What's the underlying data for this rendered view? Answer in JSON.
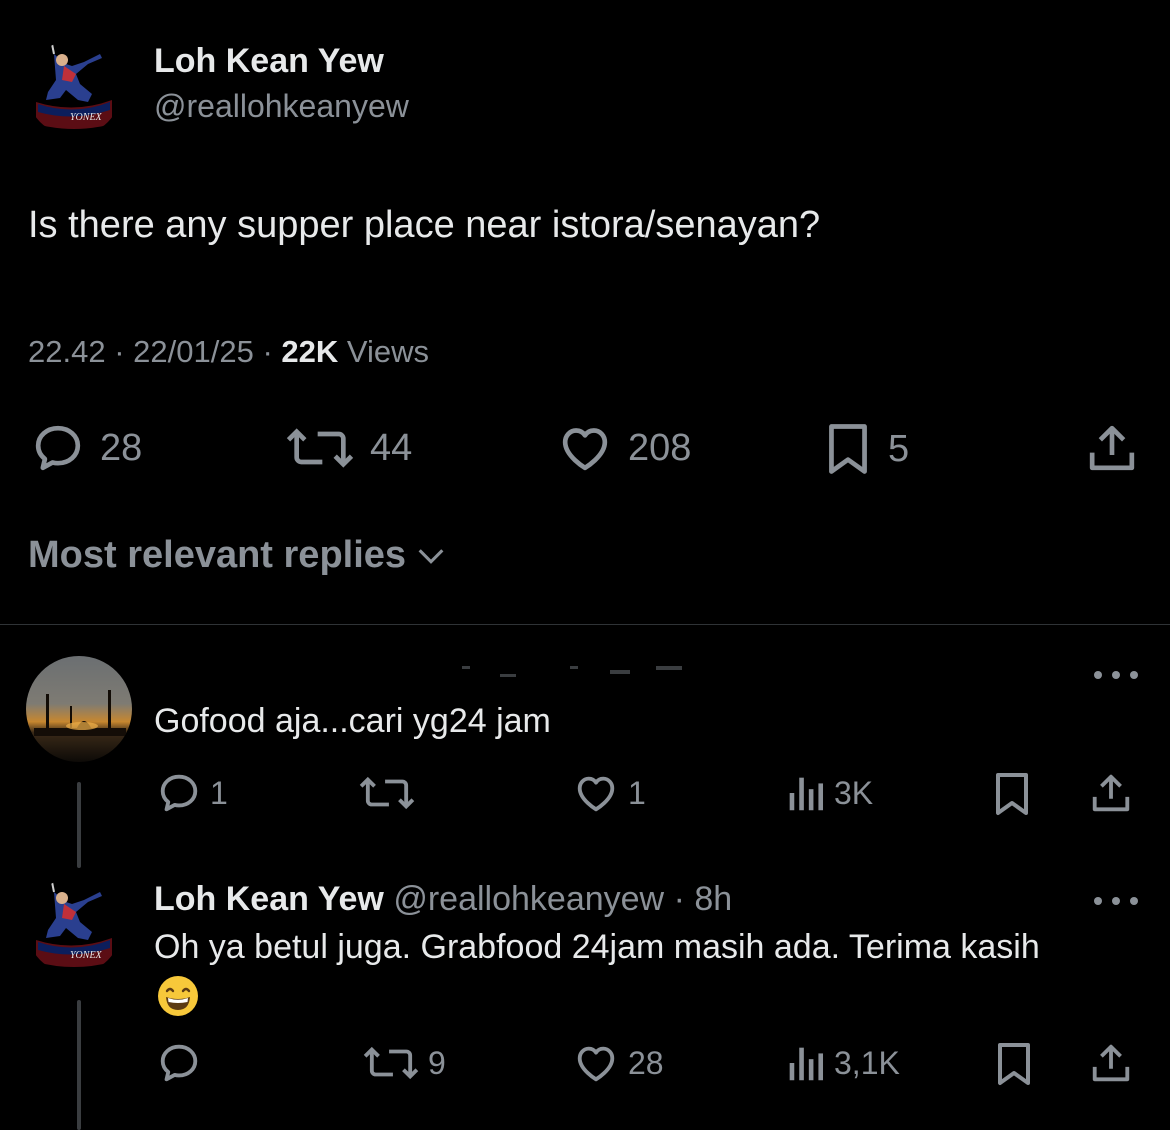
{
  "tweet": {
    "author_name": "Loh Kean Yew",
    "author_handle": "@reallohkeanyew",
    "avatar_badge": "YONEX",
    "text": "Is there any supper place near istora/senayan?",
    "time": "22.42",
    "date": "22/01/25",
    "views_count": "22K",
    "views_label": "Views",
    "replies": "28",
    "reposts": "44",
    "likes": "208",
    "bookmarks": "5"
  },
  "sort_label": "Most relevant replies",
  "replies": [
    {
      "text": "Gofood aja...cari yg24 jam",
      "replies": "1",
      "reposts": "",
      "likes": "1",
      "views": "3K"
    },
    {
      "author_name": "Loh Kean Yew",
      "author_handle": "@reallohkeanyew",
      "time_ago": "8h",
      "avatar_badge": "YONEX",
      "text": "Oh ya betul juga. Grabfood 24jam masih ada. Terima kasih",
      "emoji": "grinning-face",
      "replies": "",
      "reposts": "9",
      "likes": "28",
      "views": "3,1K"
    }
  ],
  "colors": {
    "background": "#000000",
    "primary_text": "#e7e9ea",
    "secondary_text": "#8b9198",
    "divider": "#2f3336"
  },
  "icons": [
    "reply-icon",
    "repost-icon",
    "like-icon",
    "bookmark-icon",
    "share-icon",
    "views-icon",
    "more-icon",
    "chevron-down-icon"
  ]
}
